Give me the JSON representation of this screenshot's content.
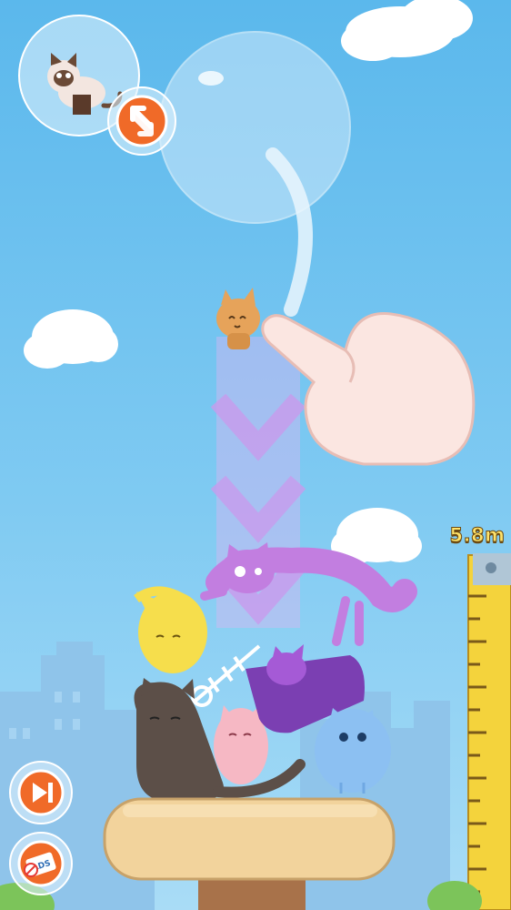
{
  "hud": {
    "height_label": "5.8m"
  },
  "buttons": {
    "next_cat_preview": "siamese-cat",
    "swap": "swap-arrows-icon",
    "skip_level": "skip-icon",
    "remove_ads": "no-ads-icon",
    "remove_ads_text": "ADS"
  },
  "colors": {
    "sky_top": "#5bb8ec",
    "ruler": "#f4d33c",
    "platform": "#f2d39c"
  }
}
